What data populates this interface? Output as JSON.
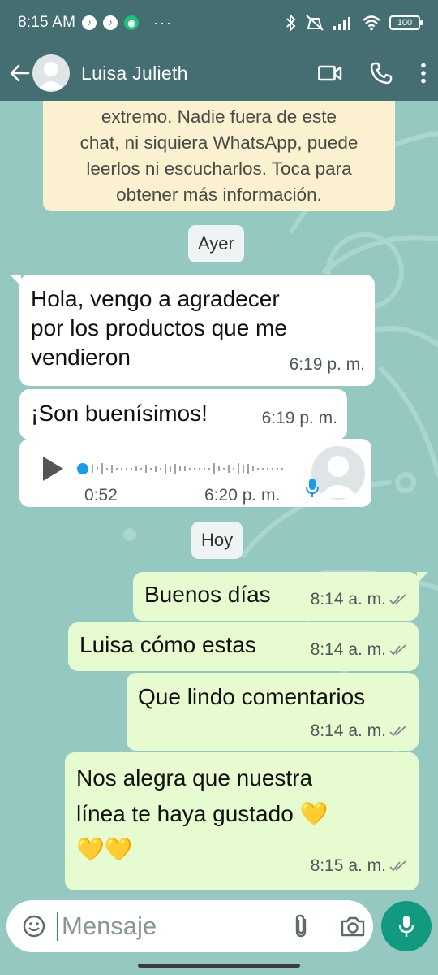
{
  "status_bar": {
    "time": "8:15 AM",
    "badges": [
      "tiktok-icon",
      "tiktok-icon",
      "vpn-icon"
    ],
    "overflow": "···",
    "battery": "100"
  },
  "header": {
    "back_icon": "arrow-left-icon",
    "contact_name": "Luisa Julieth",
    "actions": [
      "video-call-icon",
      "phone-icon",
      "more-vert-icon"
    ]
  },
  "encryption_notice": {
    "lines": [
      "extremo. Nadie fuera de este",
      "chat, ni siquiera WhatsApp, puede",
      "leerlos ni escucharlos. Toca para",
      "obtener más información."
    ]
  },
  "day_chips": {
    "yesterday": "Ayer",
    "today": "Hoy"
  },
  "messages": [
    {
      "direction": "in",
      "lines": [
        "Hola, vengo a agradecer",
        "por los productos que me",
        "vendieron"
      ],
      "time": "6:19 p. m."
    },
    {
      "direction": "in",
      "lines": [
        "¡Son buenísimos!"
      ],
      "time": "6:19 p. m."
    },
    {
      "direction": "in",
      "type": "voice",
      "duration": "0:52",
      "time": "6:20 p. m.",
      "progress": 0
    },
    {
      "direction": "out",
      "lines": [
        "Buenos días"
      ],
      "time": "8:14 a. m.",
      "status": "double-check-icon"
    },
    {
      "direction": "out",
      "lines": [
        "Luisa cómo estas"
      ],
      "time": "8:14 a. m.",
      "status": "double-check-icon"
    },
    {
      "direction": "out",
      "lines": [
        "Que lindo comentarios"
      ],
      "time": "8:14 a. m.",
      "status": "double-check-icon"
    },
    {
      "direction": "out",
      "lines": [
        "Nos alegra que nuestra",
        "línea te haya gustado 💛",
        "💛💛"
      ],
      "time": "8:15 a. m.",
      "status": "double-check-icon"
    }
  ],
  "input": {
    "placeholder": "Mensaje",
    "icons": [
      "emoji-icon",
      "attach-icon",
      "camera-icon"
    ]
  },
  "colors": {
    "header_bg": "#456e73",
    "chat_bg": "#94c8c0",
    "incoming_bubble": "#ffffff",
    "outgoing_bubble": "#e6fbd0",
    "notice_bg": "#fbf0cf",
    "accent": "#119a7f"
  }
}
